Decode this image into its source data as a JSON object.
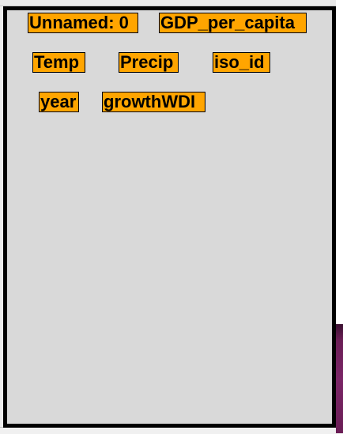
{
  "columns": [
    "Unnamed: 0",
    "GDP_per_capita",
    "Temp",
    "Precip",
    "iso_id",
    "year",
    "growthWDI"
  ],
  "colors": {
    "tag_bg": "#ffa500",
    "panel_bg": "#d9d9d9",
    "border": "#000000"
  }
}
